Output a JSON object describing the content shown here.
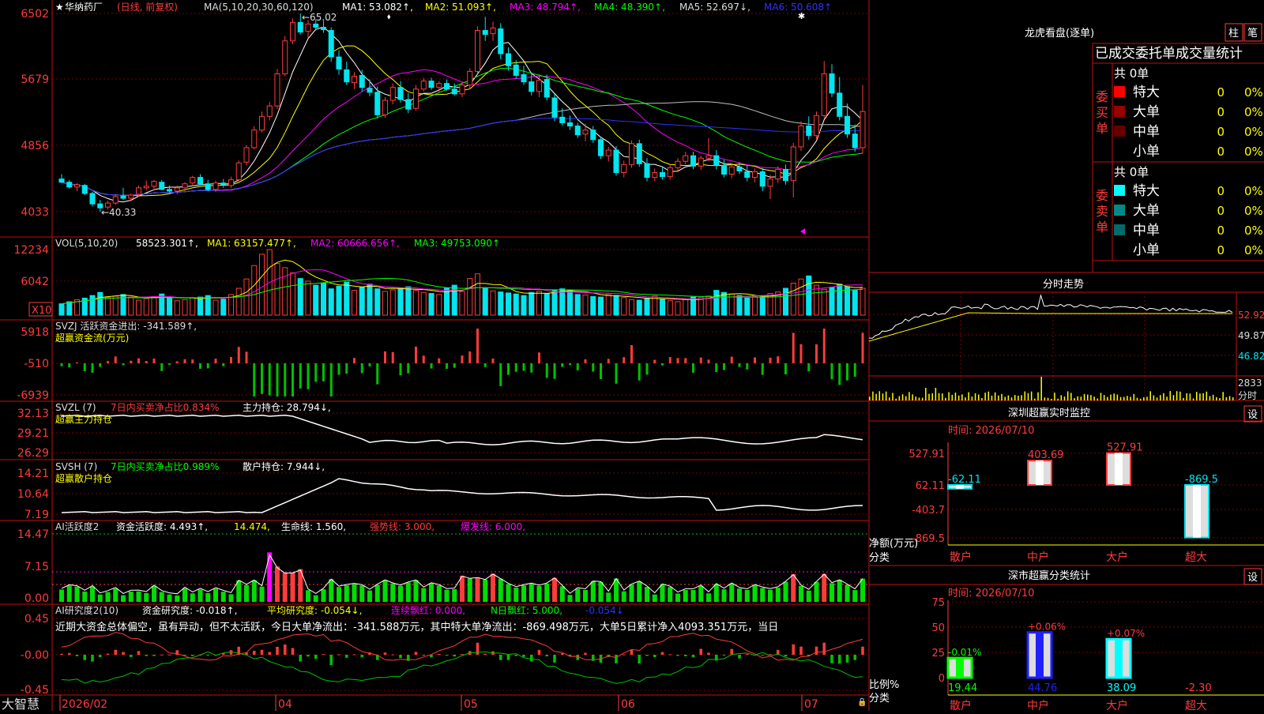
{
  "stock": {
    "name": "华纳药厂",
    "mode": "(日线, 前复权)",
    "brand": "大智慧"
  },
  "colors": {
    "up": "#ff3b3b",
    "down": "#00e5ee",
    "ma1": "#ffffff",
    "ma2": "#ffff00",
    "ma3": "#ff00ff",
    "ma4": "#00ff00",
    "ma5": "#c0c0c0",
    "ma6": "#3030ff",
    "axis": "#ff3b3b",
    "grid": "#7a0000"
  },
  "main_panel": {
    "ma_header": {
      "prefix": "MA(5,10,20,30,60,120)",
      "ma1": "MA1: 53.082↑,",
      "ma2": "MA2: 51.093↑,",
      "ma3": "MA3: 48.794↑,",
      "ma4": "MA4: 48.390↑,",
      "ma5": "MA5: 52.697↓,",
      "ma6": "MA6: 50.608↑"
    },
    "price_ticks": [
      "6502",
      "5679",
      "4856",
      "4033"
    ],
    "high_mark": "←65.02",
    "low_mark": "←40.33"
  },
  "vol_panel": {
    "header": {
      "prefix": "VOL(5,10,20)",
      "value": "58523.301↑,",
      "ma1": "MA1: 63157.477↑,",
      "ma2": "MA2: 60666.656↑,",
      "ma3": "MA3: 49753.090↑"
    },
    "ticks": [
      "12234",
      "6042"
    ],
    "unit": "X10"
  },
  "svzj_panel": {
    "header": "SVZJ  活跃资金进出: -341.589↑,",
    "subtitle": "超赢资金流(万元)",
    "ticks": [
      "5918",
      "-510",
      "-6939"
    ]
  },
  "svzl_panel": {
    "prefix": "SVZL (7)",
    "ratio": "7日内买卖净占比0.834%",
    "hold": "主力持仓: 28.794↓,",
    "subtitle": "超赢主力持仓",
    "ticks": [
      "32.13",
      "29.21",
      "26.29"
    ]
  },
  "svsh_panel": {
    "prefix": "SVSH (7)",
    "ratio": "7日内买卖净占比0.989%",
    "hold": "散户持仓: 7.944↓,",
    "subtitle": "超赢散户持仓",
    "ticks": [
      "14.21",
      "10.64",
      "7.19"
    ]
  },
  "ai_active_panel": {
    "prefix": "AI活跃度2",
    "active": "资金活跃度: 4.493↑,",
    "v2": "14.474,",
    "life": "生命线: 1.560,",
    "strong": "强势线: 3.000,",
    "burst": "爆发线: 6.000,",
    "ticks": [
      "14.47",
      "7.15",
      "0.00"
    ]
  },
  "ai_research_panel": {
    "prefix": "AI研究度2(10)",
    "research": "资金研究度: -0.018↑,",
    "avg": "平均研究度: -0.054↓,",
    "red": "连续飘红: 0.000,",
    "nred": "N日飘红: 5.000,",
    "last": "-0.054↓",
    "comment": "近期大资金总体偏空，虽有异动，但不太活跃，今日大单净流出：-341.588万元，其中特大单净流出：-869.498万元，大单5日累计净入4093.351万元，当日",
    "ticks": [
      "0.45",
      "-0.00",
      "-0.45"
    ]
  },
  "x_axis": [
    "2026/02",
    "04",
    "05",
    "06",
    "07"
  ],
  "longhu": {
    "title": "龙虎看盘(逐单)",
    "btn1": "柱",
    "btn2": "笔",
    "section_title": "已成交委托单成交量统计",
    "buy_label": "委买单",
    "sell_label": "委卖单",
    "buy_total": "共 0单",
    "sell_total": "共 0单",
    "buy_rows": [
      {
        "label": "特大",
        "count": "0",
        "pct": "0%",
        "color": "#ff0000"
      },
      {
        "label": "大单",
        "count": "0",
        "pct": "0%",
        "color": "#990000"
      },
      {
        "label": "中单",
        "count": "0",
        "pct": "0%",
        "color": "#660000"
      },
      {
        "label": "小单",
        "count": "0",
        "pct": "0%",
        "color": ""
      }
    ],
    "sell_rows": [
      {
        "label": "特大",
        "count": "0",
        "pct": "0%",
        "color": "#00ffff"
      },
      {
        "label": "大单",
        "count": "0",
        "pct": "0%",
        "color": "#008b8b"
      },
      {
        "label": "中单",
        "count": "0",
        "pct": "0%",
        "color": "#006b6b"
      },
      {
        "label": "小单",
        "count": "0",
        "pct": "0%",
        "color": ""
      }
    ]
  },
  "intraday": {
    "title": "分时走势",
    "ticks": [
      "52.92",
      "49.87",
      "46.82"
    ],
    "vol_tick": "2833",
    "vol_label": "分时"
  },
  "sz_monitor": {
    "title": "深圳超赢实时监控",
    "btn": "设",
    "time_label": "时间: 2026/07/10",
    "ticks": [
      "527.91",
      "62.11",
      "-403.7",
      "-869.5"
    ],
    "ylabel1": "净额(万元)",
    "ylabel2": "分类",
    "categories": [
      "散户",
      "中户",
      "大户",
      "超大"
    ],
    "value_labels": [
      "-62.11",
      "403.69",
      "527.91",
      "-869.5"
    ],
    "values": [
      -62.11,
      403.69,
      527.91,
      -869.5
    ]
  },
  "sz_class": {
    "title": "深市超赢分类统计",
    "btn": "设",
    "time_label": "时间: 2026/07/10",
    "ticks": [
      "75",
      "50",
      "25",
      "0"
    ],
    "ylabel1": "比例%",
    "ylabel2": "分类",
    "categories": [
      "散户",
      "中户",
      "大户",
      "超大"
    ],
    "delta_labels": [
      "-0.01%",
      "+0.06%",
      "+0.07%",
      ""
    ],
    "value_labels": [
      "19.44",
      "44.76",
      "38.09",
      "-2.30"
    ],
    "values": [
      19.44,
      44.76,
      38.09,
      -2.3
    ],
    "bar_colors": [
      "#00ff00",
      "#2020ff",
      "#00ffff",
      "#ff3b3b"
    ]
  },
  "chart_data": [
    {
      "type": "candlestick",
      "title": "华纳药厂 (日线, 前复权)",
      "ylim": [
        40.33,
        65.02
      ],
      "high_label": "65.02",
      "low_label": "40.33",
      "series": [
        {
          "name": "MA1",
          "value": 53.082
        },
        {
          "name": "MA2",
          "value": 51.093
        },
        {
          "name": "MA3",
          "value": 48.794
        },
        {
          "name": "MA4",
          "value": 48.39
        },
        {
          "name": "MA5",
          "value": 52.697
        },
        {
          "name": "MA6",
          "value": 50.608
        }
      ],
      "candles": [
        {
          "o": 44.4,
          "h": 45.0,
          "l": 43.9,
          "c": 44.0
        },
        {
          "o": 44.0,
          "h": 44.3,
          "l": 43.2,
          "c": 43.4
        },
        {
          "o": 43.4,
          "h": 43.9,
          "l": 42.9,
          "c": 43.7
        },
        {
          "o": 43.6,
          "h": 43.8,
          "l": 42.4,
          "c": 42.6
        },
        {
          "o": 42.6,
          "h": 42.8,
          "l": 41.0,
          "c": 41.3
        },
        {
          "o": 41.3,
          "h": 41.8,
          "l": 40.33,
          "c": 40.8
        },
        {
          "o": 40.9,
          "h": 41.7,
          "l": 40.6,
          "c": 41.4
        },
        {
          "o": 41.4,
          "h": 42.4,
          "l": 41.2,
          "c": 42.2
        },
        {
          "o": 42.3,
          "h": 43.3,
          "l": 41.8,
          "c": 42.0
        },
        {
          "o": 42.0,
          "h": 42.6,
          "l": 41.6,
          "c": 42.4
        },
        {
          "o": 42.5,
          "h": 43.6,
          "l": 42.2,
          "c": 43.3
        },
        {
          "o": 43.3,
          "h": 44.2,
          "l": 43.0,
          "c": 43.5
        },
        {
          "o": 43.5,
          "h": 44.3,
          "l": 43.0,
          "c": 44.1
        },
        {
          "o": 44.0,
          "h": 44.3,
          "l": 43.0,
          "c": 43.1
        },
        {
          "o": 43.1,
          "h": 43.6,
          "l": 42.7,
          "c": 42.9
        },
        {
          "o": 42.9,
          "h": 43.6,
          "l": 42.5,
          "c": 43.3
        },
        {
          "o": 43.3,
          "h": 44.0,
          "l": 42.9,
          "c": 43.8
        },
        {
          "o": 43.9,
          "h": 44.8,
          "l": 43.5,
          "c": 44.6
        },
        {
          "o": 44.6,
          "h": 45.0,
          "l": 43.6,
          "c": 43.8
        },
        {
          "o": 43.8,
          "h": 44.3,
          "l": 42.9,
          "c": 43.1
        },
        {
          "o": 43.1,
          "h": 44.2,
          "l": 42.8,
          "c": 43.9
        },
        {
          "o": 43.9,
          "h": 44.4,
          "l": 43.3,
          "c": 43.7
        },
        {
          "o": 43.6,
          "h": 44.7,
          "l": 43.3,
          "c": 44.3
        },
        {
          "o": 44.3,
          "h": 46.7,
          "l": 44.1,
          "c": 46.4
        },
        {
          "o": 46.5,
          "h": 48.6,
          "l": 46.1,
          "c": 48.3
        },
        {
          "o": 48.3,
          "h": 51.0,
          "l": 48.1,
          "c": 50.5
        },
        {
          "o": 50.5,
          "h": 52.8,
          "l": 50.2,
          "c": 52.2
        },
        {
          "o": 52.2,
          "h": 54.0,
          "l": 51.7,
          "c": 53.5
        },
        {
          "o": 53.5,
          "h": 58.1,
          "l": 53.1,
          "c": 57.5
        },
        {
          "o": 57.5,
          "h": 62.2,
          "l": 57.2,
          "c": 61.6
        },
        {
          "o": 61.6,
          "h": 64.4,
          "l": 61.2,
          "c": 63.9
        },
        {
          "o": 63.9,
          "h": 65.02,
          "l": 62.4,
          "c": 62.7
        },
        {
          "o": 62.8,
          "h": 64.2,
          "l": 62.0,
          "c": 63.7
        },
        {
          "o": 63.7,
          "h": 64.3,
          "l": 62.9,
          "c": 63.3
        },
        {
          "o": 63.3,
          "h": 64.1,
          "l": 62.6,
          "c": 63.0
        },
        {
          "o": 62.9,
          "h": 63.3,
          "l": 59.0,
          "c": 59.6
        },
        {
          "o": 59.6,
          "h": 60.4,
          "l": 57.4,
          "c": 58.1
        },
        {
          "o": 58.0,
          "h": 59.0,
          "l": 56.1,
          "c": 56.5
        },
        {
          "o": 56.4,
          "h": 57.7,
          "l": 55.6,
          "c": 57.2
        },
        {
          "o": 57.3,
          "h": 58.0,
          "l": 55.3,
          "c": 55.8
        },
        {
          "o": 55.7,
          "h": 56.8,
          "l": 54.7,
          "c": 55.2
        },
        {
          "o": 55.2,
          "h": 55.9,
          "l": 51.9,
          "c": 52.4
        },
        {
          "o": 52.4,
          "h": 54.6,
          "l": 52.0,
          "c": 54.2
        },
        {
          "o": 54.2,
          "h": 56.3,
          "l": 53.7,
          "c": 55.8
        },
        {
          "o": 55.8,
          "h": 56.6,
          "l": 53.9,
          "c": 54.3
        },
        {
          "o": 54.3,
          "h": 55.1,
          "l": 52.6,
          "c": 53.1
        },
        {
          "o": 53.2,
          "h": 56.1,
          "l": 52.9,
          "c": 55.6
        },
        {
          "o": 55.6,
          "h": 57.0,
          "l": 55.3,
          "c": 56.6
        },
        {
          "o": 56.6,
          "h": 57.0,
          "l": 55.5,
          "c": 55.8
        },
        {
          "o": 55.8,
          "h": 56.6,
          "l": 55.2,
          "c": 56.3
        },
        {
          "o": 56.3,
          "h": 56.8,
          "l": 55.4,
          "c": 55.6
        },
        {
          "o": 55.6,
          "h": 56.3,
          "l": 54.8,
          "c": 55.0
        },
        {
          "o": 55.0,
          "h": 56.4,
          "l": 54.6,
          "c": 56.1
        },
        {
          "o": 56.1,
          "h": 58.2,
          "l": 55.6,
          "c": 57.8
        },
        {
          "o": 57.8,
          "h": 63.4,
          "l": 57.5,
          "c": 62.9
        },
        {
          "o": 62.9,
          "h": 64.6,
          "l": 61.6,
          "c": 62.4
        },
        {
          "o": 62.5,
          "h": 64.0,
          "l": 61.6,
          "c": 63.2
        },
        {
          "o": 63.1,
          "h": 63.8,
          "l": 59.3,
          "c": 60.0
        },
        {
          "o": 60.0,
          "h": 60.8,
          "l": 57.9,
          "c": 58.5
        },
        {
          "o": 58.6,
          "h": 59.2,
          "l": 56.9,
          "c": 57.3
        },
        {
          "o": 57.4,
          "h": 58.5,
          "l": 56.1,
          "c": 56.5
        },
        {
          "o": 56.5,
          "h": 57.7,
          "l": 54.8,
          "c": 55.3
        },
        {
          "o": 55.3,
          "h": 57.2,
          "l": 54.6,
          "c": 56.7
        },
        {
          "o": 56.8,
          "h": 57.4,
          "l": 54.2,
          "c": 54.6
        },
        {
          "o": 54.5,
          "h": 55.0,
          "l": 51.6,
          "c": 52.1
        },
        {
          "o": 52.1,
          "h": 53.2,
          "l": 51.0,
          "c": 51.4
        },
        {
          "o": 51.4,
          "h": 52.3,
          "l": 50.5,
          "c": 51.0
        },
        {
          "o": 51.0,
          "h": 51.4,
          "l": 49.5,
          "c": 49.9
        },
        {
          "o": 50.0,
          "h": 51.3,
          "l": 49.1,
          "c": 50.5
        },
        {
          "o": 50.5,
          "h": 51.0,
          "l": 48.9,
          "c": 49.3
        },
        {
          "o": 49.3,
          "h": 49.7,
          "l": 46.9,
          "c": 47.3
        },
        {
          "o": 47.3,
          "h": 48.4,
          "l": 46.6,
          "c": 48.0
        },
        {
          "o": 48.0,
          "h": 48.5,
          "l": 44.8,
          "c": 45.2
        },
        {
          "o": 45.2,
          "h": 46.7,
          "l": 44.6,
          "c": 46.2
        },
        {
          "o": 46.2,
          "h": 49.2,
          "l": 45.8,
          "c": 48.8
        },
        {
          "o": 48.8,
          "h": 49.3,
          "l": 45.9,
          "c": 46.3
        },
        {
          "o": 46.3,
          "h": 47.0,
          "l": 44.1,
          "c": 44.6
        },
        {
          "o": 44.6,
          "h": 45.7,
          "l": 44.1,
          "c": 45.2
        },
        {
          "o": 45.2,
          "h": 45.9,
          "l": 44.3,
          "c": 44.7
        },
        {
          "o": 44.7,
          "h": 46.2,
          "l": 44.3,
          "c": 45.8
        },
        {
          "o": 45.8,
          "h": 47.0,
          "l": 45.4,
          "c": 46.6
        },
        {
          "o": 46.6,
          "h": 47.8,
          "l": 46.2,
          "c": 47.3
        },
        {
          "o": 47.3,
          "h": 47.8,
          "l": 45.6,
          "c": 46.0
        },
        {
          "o": 46.0,
          "h": 47.3,
          "l": 45.5,
          "c": 47.0
        },
        {
          "o": 47.0,
          "h": 49.5,
          "l": 46.6,
          "c": 47.3
        },
        {
          "o": 47.3,
          "h": 48.0,
          "l": 45.6,
          "c": 46.1
        },
        {
          "o": 46.1,
          "h": 46.8,
          "l": 44.6,
          "c": 45.0
        },
        {
          "o": 45.0,
          "h": 46.3,
          "l": 44.5,
          "c": 45.9
        },
        {
          "o": 45.9,
          "h": 46.5,
          "l": 45.0,
          "c": 45.4
        },
        {
          "o": 45.3,
          "h": 46.1,
          "l": 44.1,
          "c": 44.6
        },
        {
          "o": 44.6,
          "h": 45.7,
          "l": 44.0,
          "c": 45.3
        },
        {
          "o": 45.3,
          "h": 45.8,
          "l": 42.9,
          "c": 43.5
        },
        {
          "o": 43.5,
          "h": 44.9,
          "l": 41.9,
          "c": 44.4
        },
        {
          "o": 44.4,
          "h": 46.0,
          "l": 43.9,
          "c": 45.6
        },
        {
          "o": 45.6,
          "h": 46.2,
          "l": 43.7,
          "c": 44.2
        },
        {
          "o": 44.2,
          "h": 48.9,
          "l": 42.1,
          "c": 48.4
        },
        {
          "o": 48.4,
          "h": 51.6,
          "l": 47.9,
          "c": 51.0
        },
        {
          "o": 51.0,
          "h": 52.2,
          "l": 49.3,
          "c": 49.8
        },
        {
          "o": 49.8,
          "h": 52.8,
          "l": 49.4,
          "c": 52.3
        },
        {
          "o": 52.3,
          "h": 59.1,
          "l": 51.9,
          "c": 57.5
        },
        {
          "o": 57.5,
          "h": 58.7,
          "l": 54.6,
          "c": 55.1
        },
        {
          "o": 55.1,
          "h": 57.1,
          "l": 51.7,
          "c": 52.2
        },
        {
          "o": 52.2,
          "h": 53.8,
          "l": 49.5,
          "c": 50.0
        },
        {
          "o": 50.0,
          "h": 51.2,
          "l": 47.8,
          "c": 48.3
        },
        {
          "o": 48.3,
          "h": 56.1,
          "l": 47.6,
          "c": 52.8
        }
      ],
      "volume": [
        22,
        26,
        30,
        33,
        38,
        44,
        34,
        37,
        40,
        35,
        29,
        32,
        36,
        41,
        33,
        28,
        30,
        34,
        35,
        38,
        29,
        31,
        40,
        52,
        70,
        96,
        118,
        127,
        100,
        92,
        82,
        71,
        66,
        58,
        62,
        51,
        56,
        64,
        48,
        54,
        60,
        51,
        46,
        49,
        52,
        55,
        48,
        44,
        42,
        40,
        52,
        58,
        46,
        71,
        80,
        52,
        47,
        45,
        43,
        41,
        38,
        44,
        46,
        42,
        48,
        51,
        49,
        40,
        39,
        36,
        35,
        40,
        38,
        34,
        30,
        29,
        33,
        37,
        31,
        28,
        26,
        30,
        35,
        34,
        37,
        48,
        44,
        41,
        38,
        33,
        36,
        35,
        42,
        45,
        52,
        62,
        70,
        76,
        58,
        50,
        54,
        60,
        55,
        48,
        52
      ]
    }
  ]
}
